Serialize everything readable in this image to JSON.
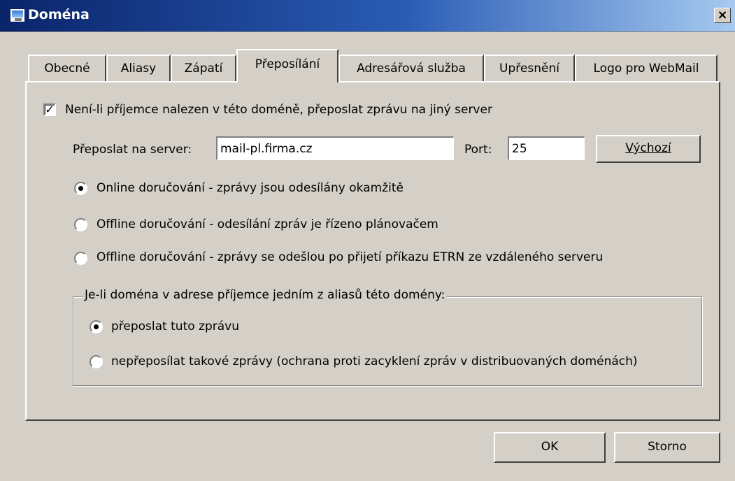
{
  "window": {
    "title": "Doména",
    "close_symbol": "×"
  },
  "tabs": [
    {
      "label": "Obecné"
    },
    {
      "label": "Aliasy"
    },
    {
      "label": "Zápatí"
    },
    {
      "label": "Přeposílání",
      "active": true
    },
    {
      "label": "Adresářová služba"
    },
    {
      "label": "Upřesnění"
    },
    {
      "label": "Logo pro WebMail"
    }
  ],
  "forward": {
    "enable_checkbox": {
      "label": "Není-li příjemce nalezen v této doméně, přeposlat zprávu na jiný server",
      "checked": true
    },
    "server_label": "Přeposlat na server:",
    "server_value": "mail-pl.firma.cz",
    "port_label": "Port:",
    "port_value": "25",
    "default_button": "Výchozí",
    "delivery_options": [
      {
        "label": "Online doručování - zprávy jsou odesílány okamžitě",
        "selected": true
      },
      {
        "label": "Offline doručování - odesílání zpráv je řízeno plánovačem",
        "selected": false
      },
      {
        "label": "Offline doručování - zprávy se odešlou po přijetí příkazu ETRN ze vzdáleného serveru",
        "selected": false
      }
    ]
  },
  "alias_group": {
    "title": "Je-li doména v adrese příjemce jedním z aliasů této domény:",
    "options": [
      {
        "label": "přeposlat tuto zprávu",
        "selected": true
      },
      {
        "label": "nepřeposílat takové zprávy (ochrana proti zacyklení zpráv v distribuovaných doménách)",
        "selected": false
      }
    ]
  },
  "buttons": {
    "ok": "OK",
    "cancel": "Storno"
  },
  "colors": {
    "dialog_bg": "#d4d0c8",
    "titlebar_start": "#0a246a",
    "titlebar_end": "#a6caf0"
  }
}
